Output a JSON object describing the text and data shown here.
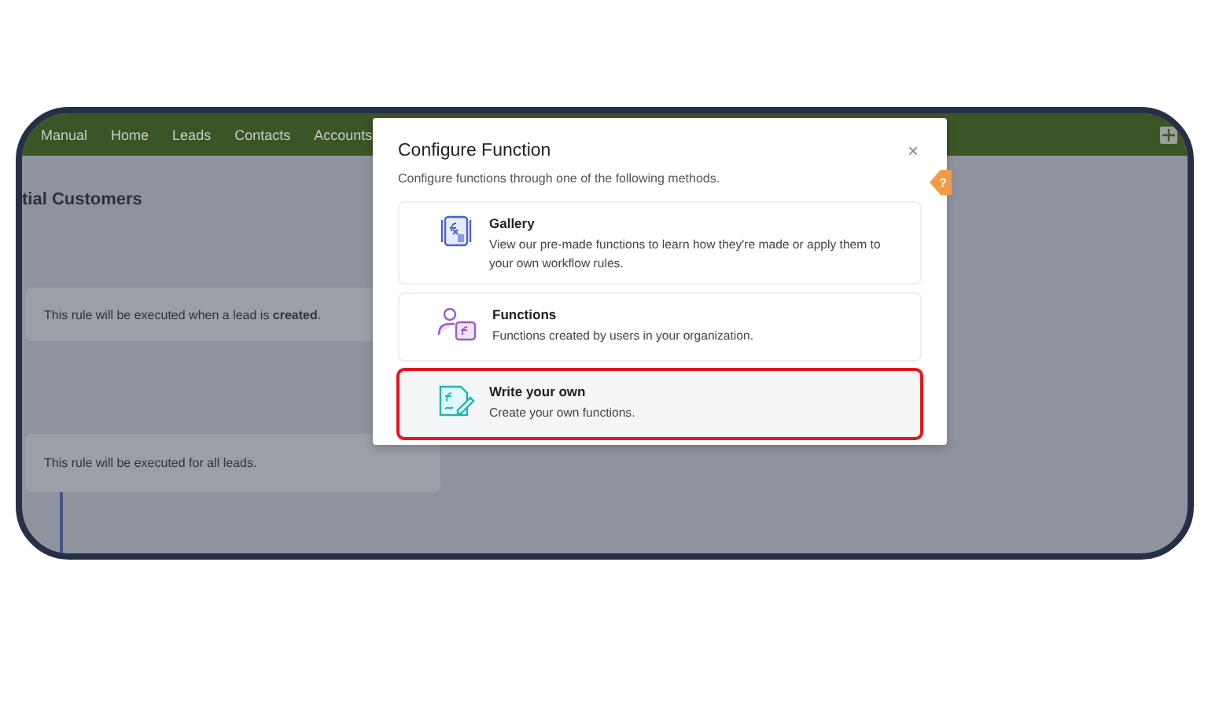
{
  "nav": {
    "items": [
      "Manual",
      "Home",
      "Leads",
      "Contacts",
      "Accounts"
    ]
  },
  "page": {
    "title": "tial Customers",
    "rules": [
      {
        "text": "This rule will be executed when a lead is **created**."
      },
      {
        "text": "This rule will be executed for all leads."
      }
    ]
  },
  "dialog": {
    "title": "Configure Function",
    "close": "×",
    "help": "?",
    "subtitle": "Configure functions through one of the following methods.",
    "options": [
      {
        "kind": "gallery",
        "title": "Gallery",
        "description": "View our pre-made functions to learn how they're made or apply them to your own workflow rules.",
        "selected": false
      },
      {
        "kind": "functions",
        "title": "Functions",
        "description": "Functions created by users in your organization.",
        "selected": false
      },
      {
        "kind": "write",
        "title": "Write your own",
        "description": "Create your own functions.",
        "selected": true
      }
    ]
  }
}
